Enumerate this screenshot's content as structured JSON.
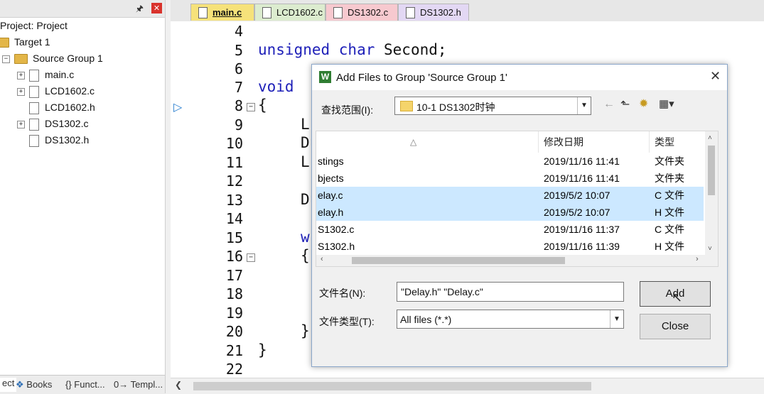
{
  "project_panel": {
    "pin_icon": "pin-icon",
    "close_label": "✕",
    "tree": {
      "project": "Project: Project",
      "target": "Target 1",
      "group": "Source Group 1",
      "files": [
        "main.c",
        "LCD1602.c",
        "LCD1602.h",
        "DS1302.c",
        "DS1302.h"
      ]
    },
    "bottom_tabs": [
      "ect",
      "Books",
      "{} Funct...",
      "0→ Templ..."
    ]
  },
  "editor_tabs": [
    {
      "label": "main.c",
      "active": true,
      "color": "#f6e27a"
    },
    {
      "label": "LCD1602.c",
      "active": false,
      "color": "#dceccf"
    },
    {
      "label": "DS1302.c",
      "active": false,
      "color": "#f7c9cf"
    },
    {
      "label": "DS1302.h",
      "active": false,
      "color": "#e3d8f4"
    }
  ],
  "editor": {
    "lines": [
      "4",
      "5",
      "6",
      "7",
      "8",
      "9",
      "10",
      "11",
      "12",
      "13",
      "14",
      "15",
      "16",
      "17",
      "18",
      "19",
      "20",
      "21",
      "22"
    ],
    "code": {
      "l5_kw": "unsigned char",
      "l5_rest": " Second;",
      "l7_kw": "void",
      "l8": "{",
      "l9": "L",
      "l10": "D",
      "l11": "L",
      "l13": "D",
      "l15": "w",
      "l16": "{",
      "l20": "}",
      "l21": "}"
    },
    "keyword_color": "#1d1fb8"
  },
  "dialog": {
    "title": "Add Files to Group 'Source Group 1'",
    "close_label": "✕",
    "look_in_label": "查找范围(I):",
    "look_in_value": "10-1 DS1302时钟",
    "columns": {
      "date": "修改日期",
      "type": "类型"
    },
    "files": [
      {
        "name": "stings",
        "date": "2019/11/16 11:41",
        "type": "文件夹",
        "selected": false
      },
      {
        "name": "bjects",
        "date": "2019/11/16 11:41",
        "type": "文件夹",
        "selected": false
      },
      {
        "name": "elay.c",
        "date": "2019/5/2 10:07",
        "type": "C 文件",
        "selected": true
      },
      {
        "name": "elay.h",
        "date": "2019/5/2 10:07",
        "type": "H 文件",
        "selected": true
      },
      {
        "name": "S1302.c",
        "date": "2019/11/16 11:37",
        "type": "C 文件",
        "selected": false
      },
      {
        "name": "S1302.h",
        "date": "2019/11/16 11:39",
        "type": "H 文件",
        "selected": false
      }
    ],
    "filename_label": "文件名(N):",
    "filename_value": "\"Delay.h\" \"Delay.c\"",
    "filetype_label": "文件类型(T):",
    "filetype_value": "All files (*.*)",
    "add_button": "Add",
    "close_button": "Close",
    "selection_color": "#cce8ff"
  }
}
